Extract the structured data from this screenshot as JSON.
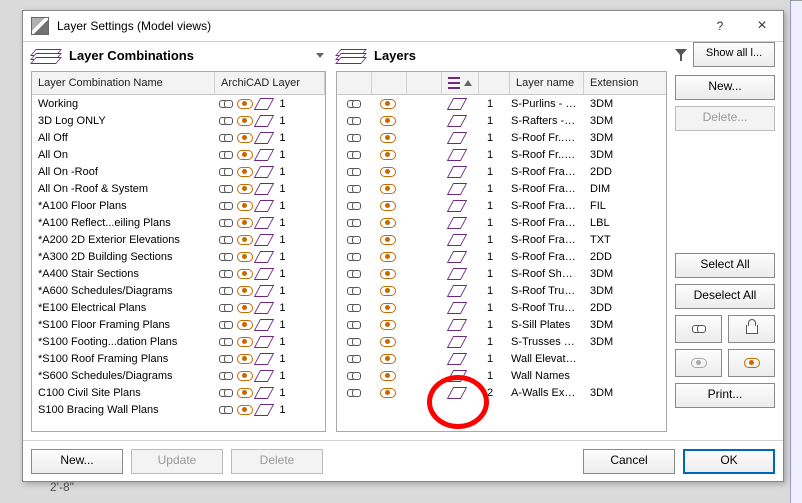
{
  "dialog": {
    "title": "Layer Settings (Model views)",
    "help": "?",
    "close": "×"
  },
  "left": {
    "heading": "Layer Combinations",
    "header_name": "Layer Combination Name",
    "header_al": "ArchiCAD Layer",
    "rows": [
      {
        "name": "Working",
        "n": "1"
      },
      {
        "name": "3D Log ONLY",
        "n": "1"
      },
      {
        "name": "All Off",
        "n": "1"
      },
      {
        "name": "All On",
        "n": "1"
      },
      {
        "name": "All On -Roof",
        "n": "1"
      },
      {
        "name": "All On -Roof & System",
        "n": "1"
      },
      {
        "name": "*A100 Floor Plans",
        "n": "1"
      },
      {
        "name": "*A100 Reflect...eiling Plans",
        "n": "1"
      },
      {
        "name": "*A200 2D Exterior Elevations",
        "n": "1"
      },
      {
        "name": "*A300 2D Building Sections",
        "n": "1"
      },
      {
        "name": "*A400 Stair Sections",
        "n": "1"
      },
      {
        "name": "*A600 Schedules/Diagrams",
        "n": "1"
      },
      {
        "name": "*E100 Electrical Plans",
        "n": "1"
      },
      {
        "name": "*S100 Floor Framing Plans",
        "n": "1"
      },
      {
        "name": "*S100 Footing...dation Plans",
        "n": "1"
      },
      {
        "name": "*S100 Roof Framing Plans",
        "n": "1"
      },
      {
        "name": "*S600 Schedules/Diagrams",
        "n": "1"
      },
      {
        "name": "C100 Civil Site Plans",
        "n": "1"
      },
      {
        "name": "S100 Bracing Wall Plans",
        "n": "1"
      }
    ]
  },
  "right": {
    "heading": "Layers",
    "header_name": "Layer name",
    "header_ext": "Extension",
    "rows": [
      {
        "n": "1",
        "name": "S-Purlins - Log & RS",
        "ext": "3DM"
      },
      {
        "n": "1",
        "name": "S-Rafters - Log & RS",
        "ext": "3DM"
      },
      {
        "n": "1",
        "name": "S-Roof  Fr...g (_misc)",
        "ext": "3DM"
      },
      {
        "n": "1",
        "name": "S-Roof  Fr...ng (wood)",
        "ext": "3DM"
      },
      {
        "n": "1",
        "name": "S-Roof Framing Plan",
        "ext": "2DD"
      },
      {
        "n": "1",
        "name": "S-Roof Framing Plan",
        "ext": "DIM"
      },
      {
        "n": "1",
        "name": "S-Roof Framing Plan",
        "ext": "FIL"
      },
      {
        "n": "1",
        "name": "S-Roof Framing Plan",
        "ext": "LBL"
      },
      {
        "n": "1",
        "name": "S-Roof Framing Plan",
        "ext": "TXT"
      },
      {
        "n": "1",
        "name": "S-Roof Framing",
        "ext": "2DD"
      },
      {
        "n": "1",
        "name": "S-Roof Sheathing",
        "ext": "3DM"
      },
      {
        "n": "1",
        "name": "S-Roof Tru...s(prefab)",
        "ext": "3DM"
      },
      {
        "n": "1",
        "name": "S-Roof Trusses",
        "ext": "2DD"
      },
      {
        "n": "1",
        "name": "S-Sill Plates",
        "ext": "3DM"
      },
      {
        "n": "1",
        "name": "S-Trusses - Log & RS",
        "ext": "3DM"
      },
      {
        "n": "1",
        "name": "Wall Elevations",
        "ext": ""
      },
      {
        "n": "1",
        "name": "Wall Names",
        "ext": ""
      },
      {
        "n": "2",
        "name": "A-Walls Exterior",
        "ext": "3DM"
      }
    ]
  },
  "side": {
    "showall": "Show all l...",
    "new": "New...",
    "delete": "Delete...",
    "select_all": "Select All",
    "deselect_all": "Deselect All",
    "print": "Print..."
  },
  "footer": {
    "new": "New...",
    "update": "Update",
    "delete": "Delete",
    "cancel": "Cancel",
    "ok": "OK"
  },
  "bg": {
    "dim": "2'-8\""
  }
}
